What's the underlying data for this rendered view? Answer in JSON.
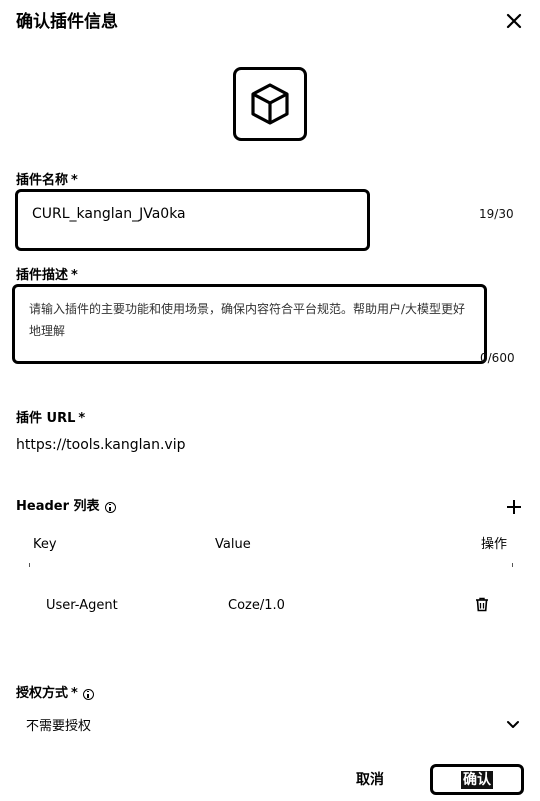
{
  "dialog": {
    "title": "确认插件信息",
    "close_icon": "close-icon"
  },
  "plugin_icon": "cube-icon",
  "name_field": {
    "label": "插件名称",
    "required_mark": "*",
    "value": "CURL_kanglan_JVa0ka",
    "counter": "19/30"
  },
  "desc_field": {
    "label": "插件描述",
    "required_mark": "*",
    "placeholder": "请输入插件的主要功能和使用场景，确保内容符合平台规范。帮助用户/大模型更好地理解",
    "counter": "0/600"
  },
  "url_field": {
    "label": "插件 URL",
    "required_mark": "*",
    "value": "https://tools.kanglan.vip"
  },
  "headers": {
    "label": "Header 列表",
    "info_icon": "info-icon",
    "add_icon": "plus-icon",
    "columns": [
      "Key",
      "Value",
      "操作"
    ],
    "rows": [
      {
        "key": "User-Agent",
        "value": "Coze/1.0",
        "action_icon": "trash-icon"
      }
    ]
  },
  "auth": {
    "label": "授权方式",
    "required_mark": "*",
    "info_icon": "info-icon",
    "selected": "不需要授权",
    "dropdown_icon": "chevron-down-icon"
  },
  "footer": {
    "cancel_label": "取消",
    "confirm_label": "确认"
  }
}
